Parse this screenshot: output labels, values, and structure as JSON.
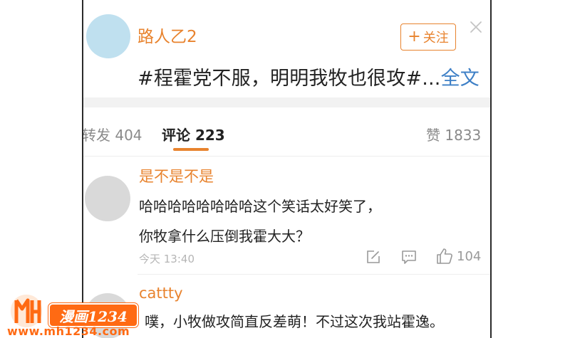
{
  "post": {
    "username": "路人乙2",
    "follow_label": "关注",
    "text": "#程霍党不服，明明我牧也很攻#...",
    "more_label": "全文"
  },
  "tabs": [
    {
      "label": "转发 404"
    },
    {
      "label": "评论 223"
    },
    {
      "label": "赞 1833"
    }
  ],
  "comments": [
    {
      "username": "是不是不是",
      "lines": [
        "哈哈哈哈哈哈哈哈这个笑话太好笑了，",
        "你牧拿什么压倒我霍大大？"
      ],
      "time": "今天 13:40",
      "likes": "104"
    },
    {
      "username": "cattty",
      "lines": [
        "噗，小牧做攻简直反差萌！不过这次我站霍逸。"
      ]
    }
  ],
  "watermark": {
    "badge": "漫画1234",
    "url": "www.mh1234.com"
  },
  "colors": {
    "accent": "#e8832e",
    "link": "#3d7fc6",
    "watermark": "#ff6a13"
  }
}
